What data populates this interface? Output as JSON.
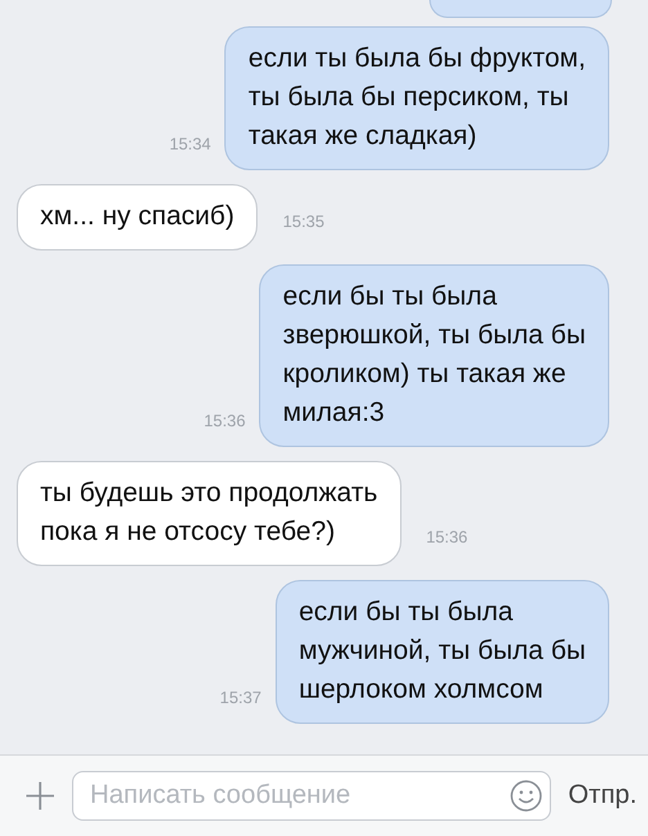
{
  "chat": {
    "messages": [
      {
        "kind": "out",
        "text": "если ты была бы фруктом,\nты была бы персиком, ты\nтакая же сладкая)",
        "time": "15:34"
      },
      {
        "kind": "in",
        "text": "хм... ну спасиб)",
        "time": "15:35"
      },
      {
        "kind": "out",
        "text": "если бы ты была\nзверюшкой, ты была бы\nкроликом) ты такая же\nмилая:3",
        "time": "15:36"
      },
      {
        "kind": "in",
        "text": "ты будешь это продолжать\nпока я не отсосу тебе?)",
        "time": "15:36"
      },
      {
        "kind": "out",
        "text": "если бы ты была\nмужчиной, ты была бы\nшерлоком холмсом",
        "time": "15:37"
      }
    ]
  },
  "composer": {
    "placeholder": "Написать сообщение",
    "send": "Отпр."
  }
}
